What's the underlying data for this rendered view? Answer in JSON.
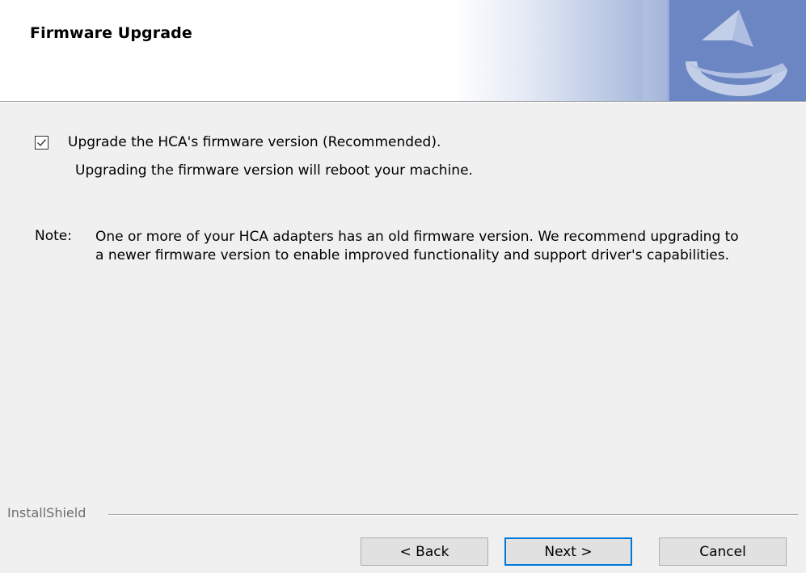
{
  "header": {
    "title": "Firmware Upgrade"
  },
  "options": {
    "upgrade_checkbox_label": "Upgrade the HCA's firmware version (Recommended).",
    "upgrade_checked": true,
    "reboot_notice": "Upgrading the firmware version will reboot your machine."
  },
  "note": {
    "label": "Note:",
    "text": "One or more of your HCA adapters has an old firmware version. We recommend upgrading to a newer firmware version to enable improved functionality and support driver's capabilities."
  },
  "footer": {
    "brand": "InstallShield",
    "back_label": "< Back",
    "next_label": "Next >",
    "cancel_label": "Cancel"
  },
  "colors": {
    "dialog_bg": "#f0f0f0",
    "header_bg": "#ffffff",
    "focus_border": "#0078d7",
    "header_graphic_blue": "#6b86c2"
  },
  "icons": {
    "header_logo": "installshield-logo-icon",
    "checkbox_mark": "checkmark-icon"
  }
}
